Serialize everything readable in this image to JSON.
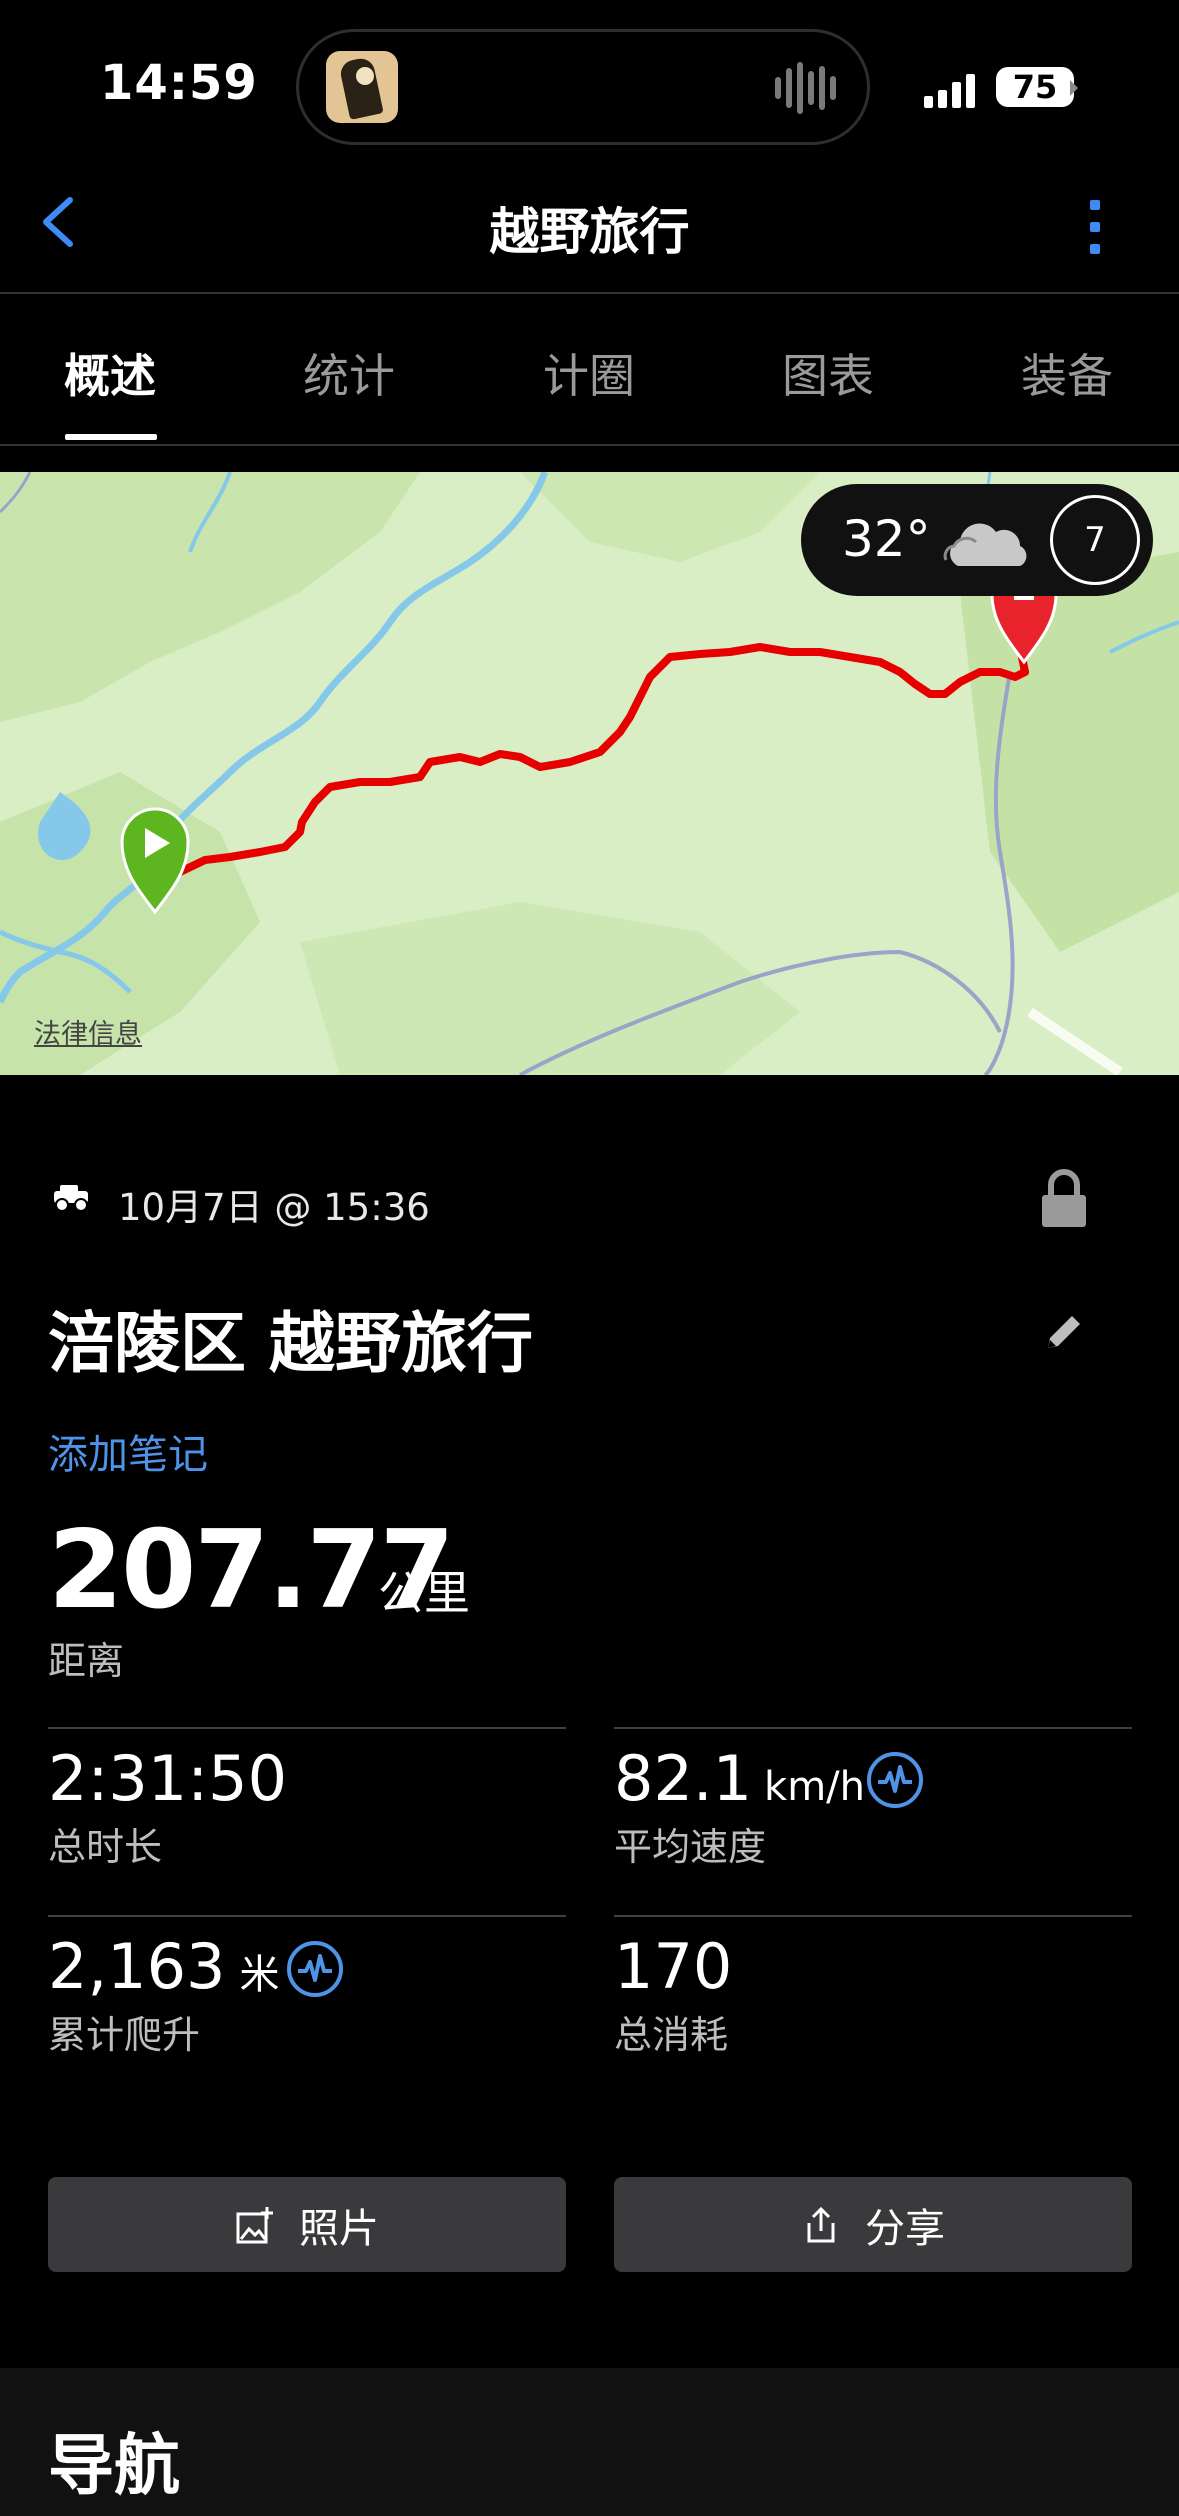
{
  "status_bar": {
    "time": "14:59",
    "battery": "75"
  },
  "header": {
    "title": "越野旅行",
    "back_icon": "chevron-left-icon",
    "menu_icon": "more-vertical-icon"
  },
  "tabs": [
    {
      "label": "概述",
      "active": true
    },
    {
      "label": "统计",
      "active": false
    },
    {
      "label": "计圈",
      "active": false
    },
    {
      "label": "图表",
      "active": false
    },
    {
      "label": "装备",
      "active": false
    }
  ],
  "map": {
    "temperature": "32°",
    "weather_icon": "cloud-icon",
    "wind": "7",
    "legal_link": "法律信息",
    "route_color": "#e60000"
  },
  "activity": {
    "date_time": "10月7日 @ 15:36",
    "title": "涪陵区 越野旅行",
    "add_note": "添加笔记",
    "distance": {
      "value": "207.77",
      "unit": "公里",
      "label": "距离"
    },
    "stats": [
      {
        "value": "2:31:50",
        "unit": "",
        "label": "总时长"
      },
      {
        "value": "82.1",
        "unit": "km/h",
        "label": "平均速度"
      },
      {
        "value": "2,163",
        "unit": "米",
        "label": "累计爬升"
      },
      {
        "value": "170",
        "unit": "",
        "label": "总消耗"
      }
    ]
  },
  "buttons": {
    "photos": "照片",
    "share": "分享"
  },
  "section": {
    "navigation": "导航"
  },
  "colors": {
    "accent": "#4f93e8",
    "route": "#e60000",
    "start_pin": "#5db520",
    "end_pin": "#e8232b"
  }
}
